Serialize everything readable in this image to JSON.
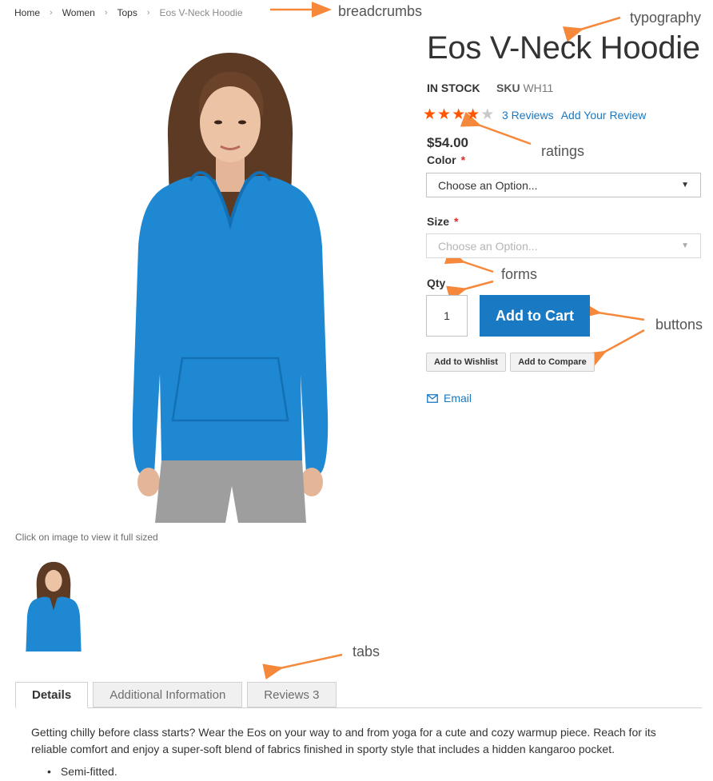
{
  "breadcrumbs": {
    "items": [
      "Home",
      "Women",
      "Tops"
    ],
    "current": "Eos V-Neck Hoodie",
    "separator": "›"
  },
  "annotations": {
    "breadcrumbs": "breadcrumbs",
    "typography": "typography",
    "ratings": "ratings",
    "forms": "forms",
    "buttons": "buttons",
    "tabs": "tabs",
    "color": "#f5883a"
  },
  "gallery": {
    "caption": "Click on image to view it full sized"
  },
  "product": {
    "title": "Eos V-Neck Hoodie",
    "stock": "In stock",
    "sku_label": "SKU",
    "sku_value": "WH11",
    "rating": {
      "filled": 4,
      "total": 5
    },
    "reviews_link": "3 Reviews",
    "add_review_link": "Add Your Review",
    "price": "$54.00",
    "color_label": "Color",
    "color_select": "Choose an Option...",
    "size_label": "Size",
    "size_select": "Choose an Option...",
    "required_mark": "*",
    "qty_label": "Qty",
    "qty_value": "1",
    "add_to_cart": "Add to Cart",
    "add_to_wishlist": "Add to Wishlist",
    "add_to_compare": "Add to Compare",
    "email": "Email"
  },
  "tabs": {
    "items": [
      "Details",
      "Additional Information",
      "Reviews 3"
    ],
    "active": "Details"
  },
  "details": {
    "description": "Getting chilly before class starts? Wear the Eos on your way to and from yoga for a cute and cozy warmup piece. Reach for its reliable comfort and enjoy a super-soft blend of fabrics finished in sporty style that includes a hidden kangaroo pocket.",
    "bullets": [
      "Semi-fitted."
    ]
  },
  "colors": {
    "primary": "#1979c3",
    "star": "#ff5501",
    "hoodie": "#1e88d3",
    "required": "#e02b27"
  }
}
